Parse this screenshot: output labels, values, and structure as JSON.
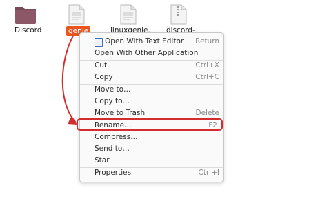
{
  "desktop": {
    "files": [
      {
        "label": "Discord",
        "type": "folder"
      },
      {
        "label": "genie",
        "type": "document"
      },
      {
        "label": "linuxgenie.",
        "type": "document"
      },
      {
        "label": "discord-",
        "type": "archive"
      }
    ]
  },
  "context_menu": {
    "items": [
      {
        "label": "Open With Text Editor",
        "shortcut": "Return"
      },
      {
        "label": "Open With Other Application",
        "shortcut": ""
      },
      {
        "label": "Cut",
        "shortcut": "Ctrl+X"
      },
      {
        "label": "Copy",
        "shortcut": "Ctrl+C"
      },
      {
        "label": "Move to…",
        "shortcut": ""
      },
      {
        "label": "Copy to…",
        "shortcut": ""
      },
      {
        "label": "Move to Trash",
        "shortcut": "Delete"
      },
      {
        "label": "Rename…",
        "shortcut": "F2"
      },
      {
        "label": "Compress…",
        "shortcut": ""
      },
      {
        "label": "Send to…",
        "shortcut": ""
      },
      {
        "label": "Star",
        "shortcut": ""
      },
      {
        "label": "Properties",
        "shortcut": "Ctrl+I"
      }
    ]
  },
  "colors": {
    "selection": "#e95420",
    "annotation": "#d22c2c",
    "folder": "#7a4a59"
  },
  "icons": {
    "folder": "folder-icon",
    "document": "text-document-icon",
    "archive": "archive-icon",
    "editor": "text-editor-icon"
  }
}
